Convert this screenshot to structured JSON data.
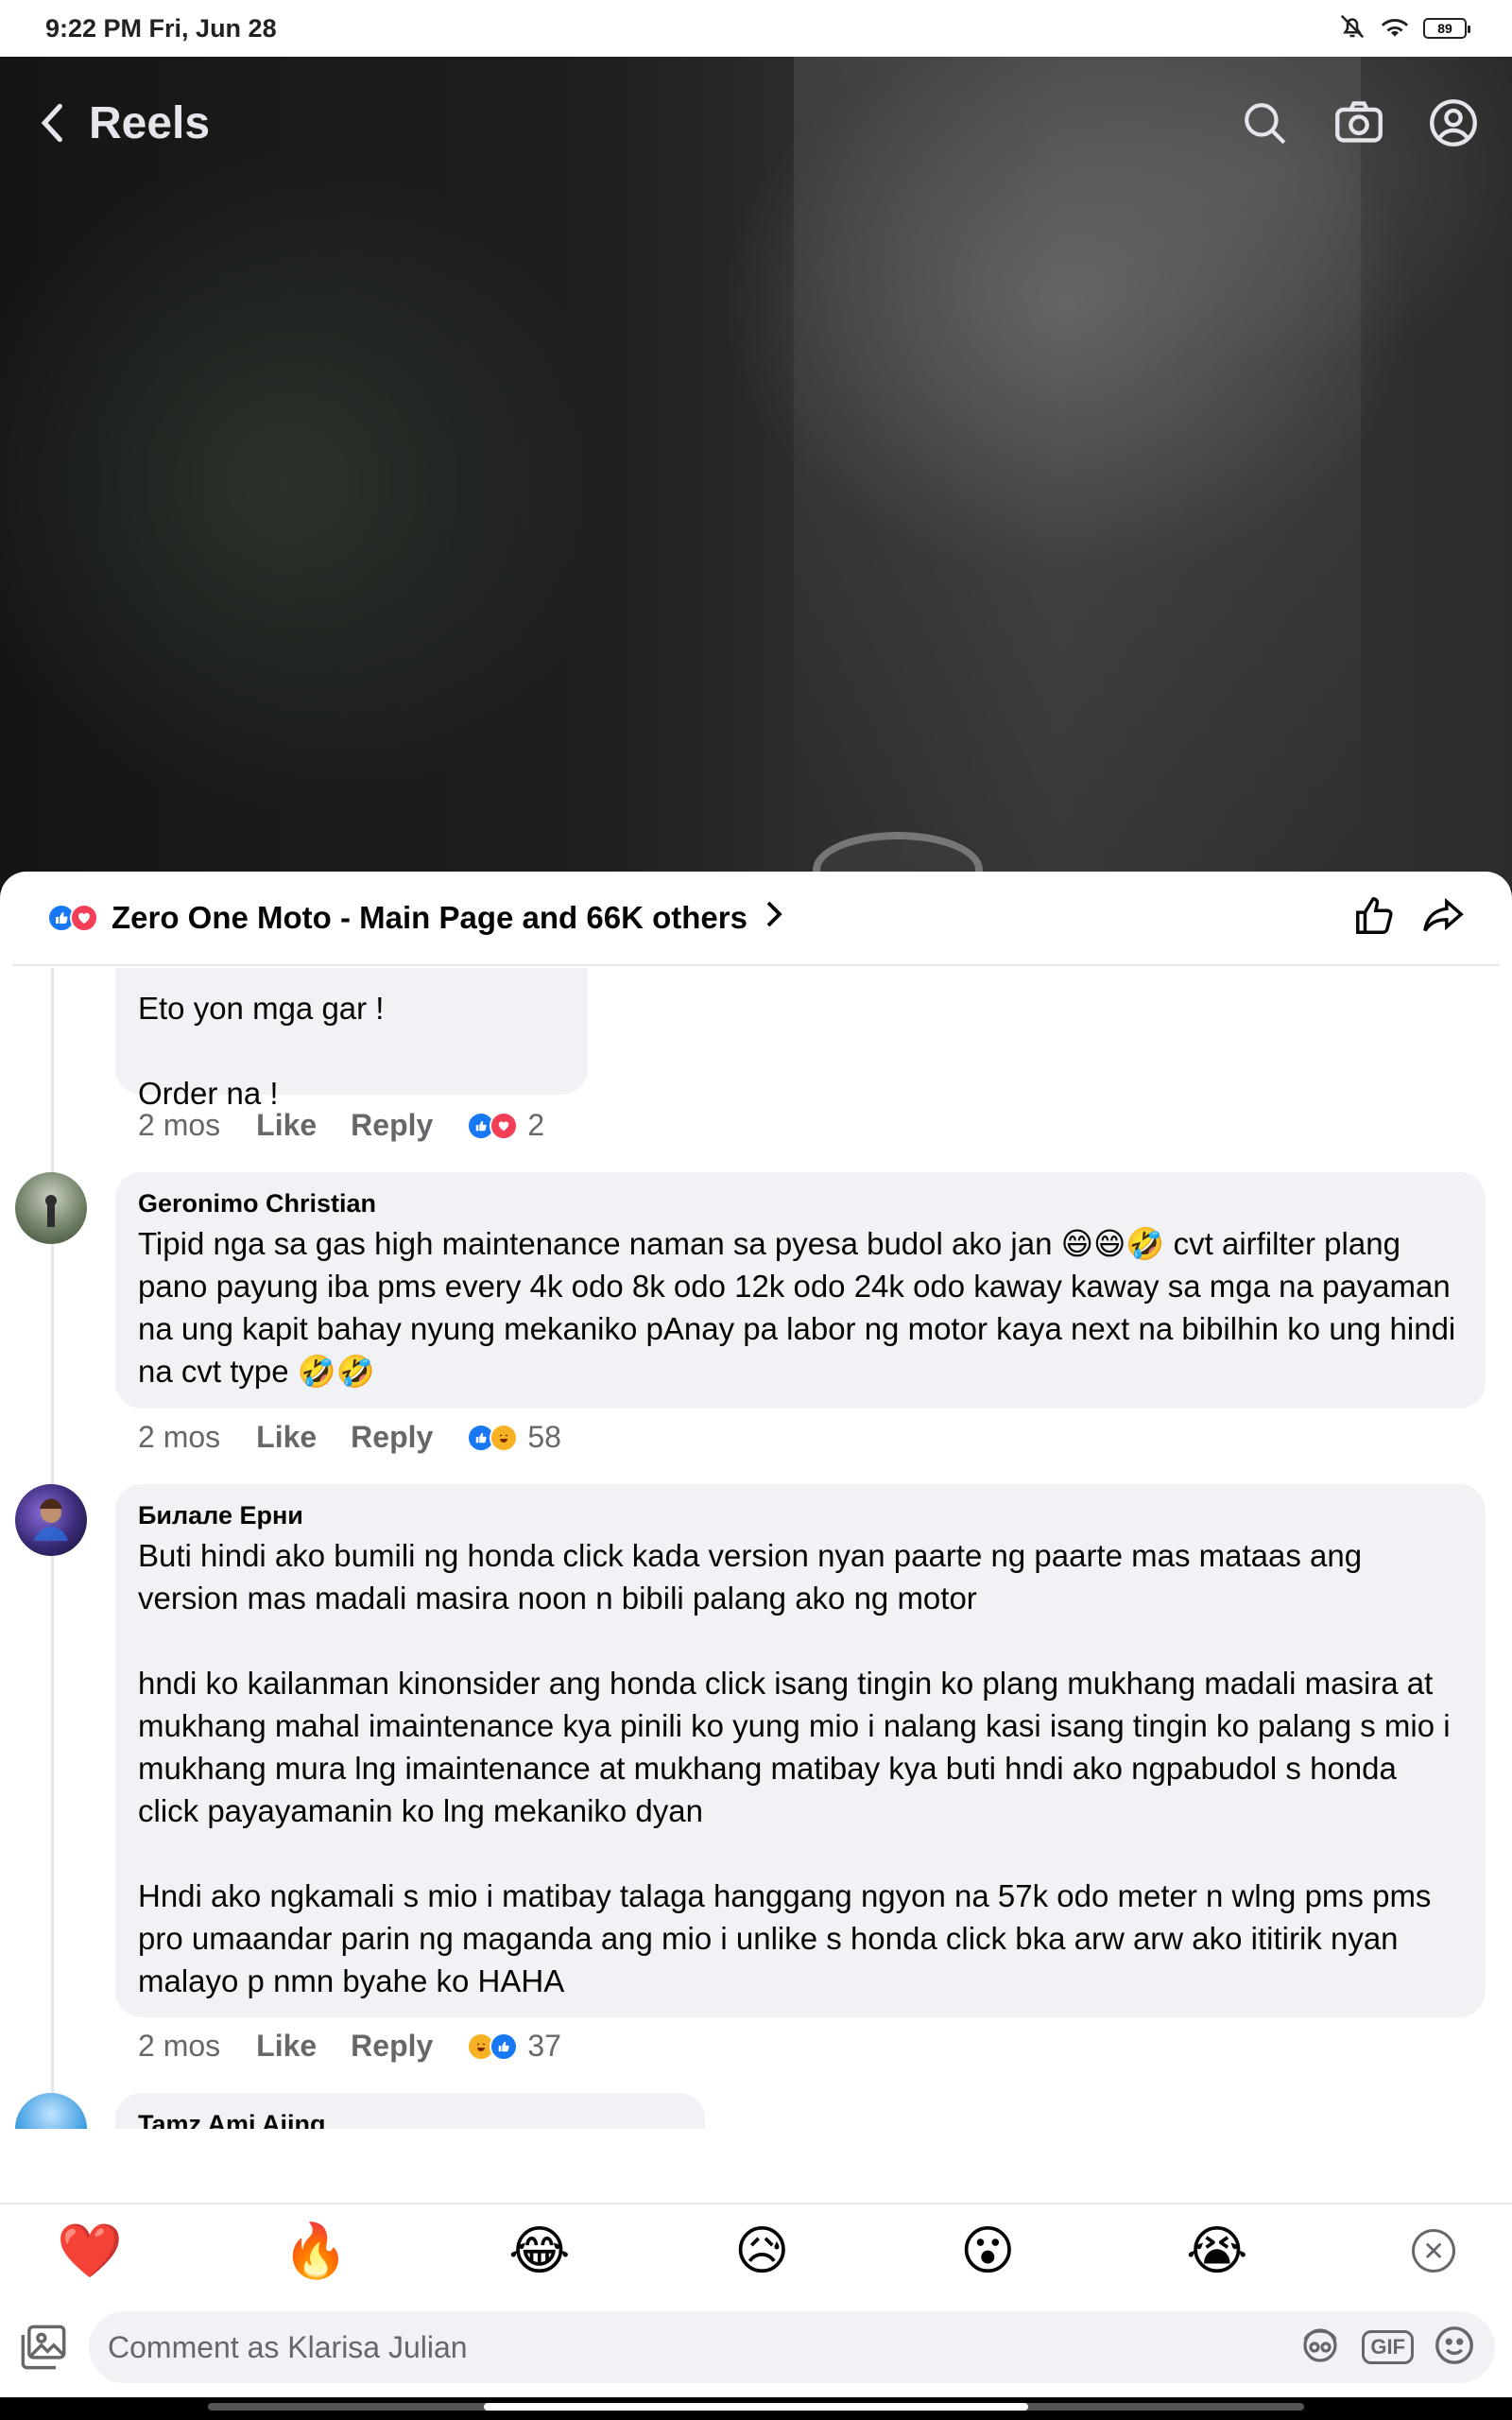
{
  "status_bar": {
    "time": "9:22 PM Fri, Jun 28",
    "battery": "89"
  },
  "topbar": {
    "title": "Reels"
  },
  "sheet": {
    "reaction_summary": "Zero One Moto - Main Page and 66K others"
  },
  "comments": [
    {
      "author": "",
      "text": "Eto yon mga gar !\n\nOrder na !",
      "time": "2 mos",
      "like": "Like",
      "reply": "Reply",
      "reactions": [
        "like",
        "love"
      ],
      "count": "2"
    },
    {
      "author": "Geronimo Christian",
      "text": "Tipid nga sa gas high maintenance naman sa pyesa budol ako jan 😄😄🤣 cvt airfilter plang pano payung iba pms every 4k odo 8k odo 12k odo 24k odo kaway kaway sa mga na payaman na ung kapit bahay nyung mekaniko pAnay pa labor ng motor kaya next na bibilhin ko ung hindi na cvt type 🤣🤣",
      "time": "2 mos",
      "like": "Like",
      "reply": "Reply",
      "reactions": [
        "like",
        "haha"
      ],
      "count": "58"
    },
    {
      "author": "Билале Ерни",
      "text": "Buti hindi ako bumili ng honda click kada version nyan paarte ng paarte mas mataas ang version mas madali masira noon n bibili palang ako ng motor\n\nhndi ko kailanman kinonsider ang honda click isang tingin ko plang mukhang madali masira at mukhang mahal imaintenance kya pinili ko yung mio i nalang kasi isang tingin ko palang s mio i mukhang mura lng imaintenance at mukhang matibay kya buti hndi ako ngpabudol s honda click payayamanin ko lng mekaniko dyan\n\nHndi ako ngkamali s mio i matibay talaga hanggang ngyon na 57k odo meter n wlng pms pms pro umaandar parin ng maganda ang mio i unlike s honda click bka arw arw ako ititirik nyan malayo p nmn byahe ko HAHA",
      "time": "2 mos",
      "like": "Like",
      "reply": "Reply",
      "reactions": [
        "haha",
        "like"
      ],
      "count": "37"
    },
    {
      "author": "Tamz Ami Aiing",
      "text": ""
    }
  ],
  "quick_reactions": [
    "❤️",
    "🔥",
    "😂",
    "😥",
    "😮",
    "😭"
  ],
  "composer": {
    "placeholder": "Comment as Klarisa Julian",
    "gif_label": "GIF"
  }
}
